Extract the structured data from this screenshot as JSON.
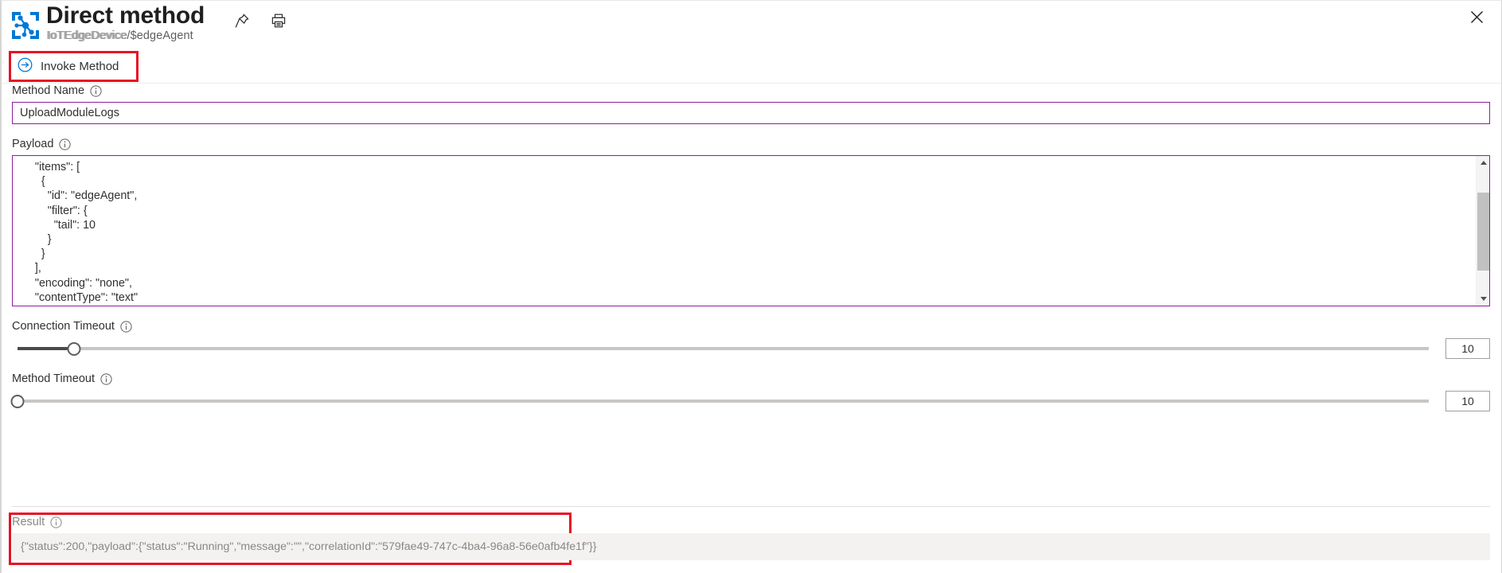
{
  "header": {
    "icon_name": "direct-method-icon",
    "title": "Direct method",
    "subtitle_prefix": "IoTEdgeDevice",
    "subtitle_suffix": "/$edgeAgent",
    "subtitle_full": "IoTEdgeDevice/$edgeAgent",
    "pin_icon": "pin-icon",
    "print_icon": "print-icon",
    "close_icon": "close-icon"
  },
  "command_bar": {
    "invoke_label": "Invoke Method",
    "invoke_icon": "arrow-right-circle-icon",
    "highlight_color": "#e81123"
  },
  "form": {
    "method_name": {
      "label": "Method Name",
      "info_icon": "info-icon",
      "value": "UploadModuleLogs",
      "placeholder": "Method Name"
    },
    "payload": {
      "label": "Payload",
      "info_icon": "info-icon",
      "value": "    \"items\": [\n      {\n        \"id\": \"edgeAgent\",\n        \"filter\": {\n          \"tail\": 10\n        }\n      }\n    ],\n    \"encoding\": \"none\",\n    \"contentType\": \"text\"",
      "scrollbar": {
        "up_icon": "scroll-up-arrow-icon",
        "down_icon": "scroll-down-arrow-icon"
      }
    },
    "connection_timeout": {
      "label": "Connection Timeout",
      "info_icon": "info-icon",
      "value": "10",
      "percent": 4
    },
    "method_timeout": {
      "label": "Method Timeout",
      "info_icon": "info-icon",
      "value": "10",
      "percent": 0
    }
  },
  "result": {
    "label": "Result",
    "info_icon": "info-icon",
    "value": "{\"status\":200,\"payload\":{\"status\":\"Running\",\"message\":\"\",\"correlationId\":\"579fae49-747c-4ba4-96a8-56e0afb4fe1f\"}}",
    "highlight_color": "#e81123"
  },
  "colors": {
    "accent_purple": "#8a1f9b",
    "azure_blue": "#0078d4",
    "highlight_red": "#e81123",
    "result_bg": "#f3f2f1"
  }
}
